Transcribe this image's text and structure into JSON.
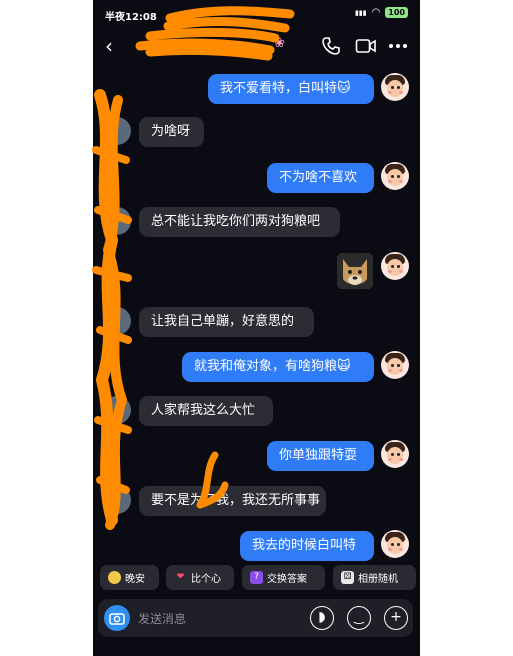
{
  "status_bar": {
    "time": "半夜12:08",
    "signal": "4G",
    "battery": "100"
  },
  "header": {
    "title_visible": "",
    "icons": [
      "back-icon",
      "phone-icon",
      "video-icon",
      "more-icon"
    ]
  },
  "messages": [
    {
      "from": "me",
      "text": "我不爱看特，白叫特🐱"
    },
    {
      "from": "them",
      "text": "为啥呀"
    },
    {
      "from": "me",
      "text": "不为啥不喜欢"
    },
    {
      "from": "them",
      "text": "总不能让我吃你们两对狗粮吧"
    },
    {
      "from": "me",
      "type": "sticker",
      "icon": "dog-face-sticker"
    },
    {
      "from": "them",
      "text": "让我自己单蹦，好意思的"
    },
    {
      "from": "me",
      "text": "就我和俺对象，有啥狗粮🙀"
    },
    {
      "from": "them",
      "text": "人家帮我这么大忙"
    },
    {
      "from": "me",
      "text": "你单独跟特耍"
    },
    {
      "from": "them",
      "text": "要不是为了我，我还无所事事"
    },
    {
      "from": "me",
      "text": "我去的时候白叫特"
    }
  ],
  "quick_actions": [
    {
      "label": "晚安",
      "icon": "moon-icon"
    },
    {
      "label": "比个心",
      "icon": "heart-icon"
    },
    {
      "label": "交换答案",
      "icon": "question-icon"
    },
    {
      "label": "相册随机",
      "icon": "dice-icon"
    }
  ],
  "input": {
    "placeholder": "发送消息"
  },
  "colors": {
    "background": "#0b0b14",
    "my_bubble": "#2f7cf6",
    "their_bubble": "#2c2c34",
    "scribble": "#ff8c00"
  }
}
